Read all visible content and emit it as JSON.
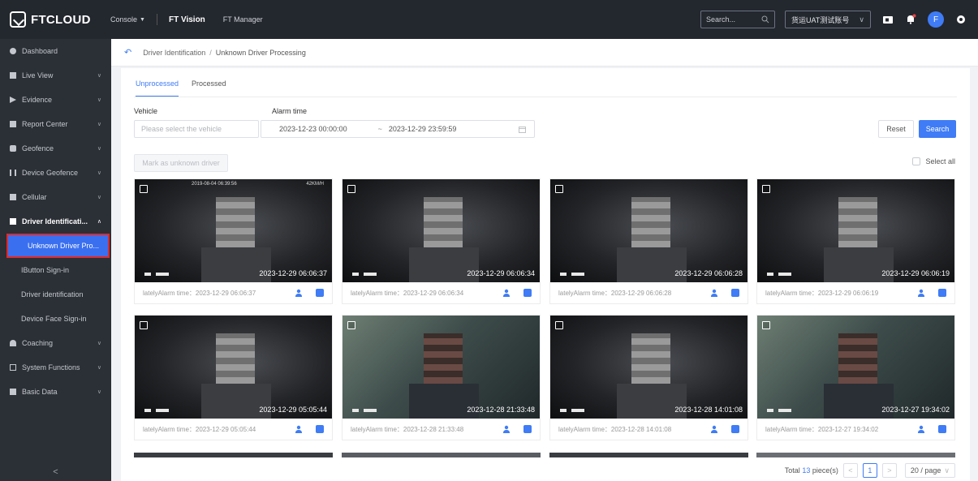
{
  "header": {
    "brand": "FTCLOUD",
    "console": "Console",
    "nav": [
      "FT Vision",
      "FT Manager"
    ],
    "search_placeholder": "Search...",
    "account": "货运UAT测试账号",
    "avatar_letter": "F"
  },
  "sidebar": {
    "items": [
      {
        "label": "Dashboard",
        "icon": "dashboard-icon",
        "has_children": false
      },
      {
        "label": "Live View",
        "icon": "live-view-icon",
        "has_children": true
      },
      {
        "label": "Evidence",
        "icon": "evidence-icon",
        "has_children": true
      },
      {
        "label": "Report Center",
        "icon": "report-icon",
        "has_children": true
      },
      {
        "label": "Geofence",
        "icon": "geofence-icon",
        "has_children": true
      },
      {
        "label": "Device Geofence",
        "icon": "device-geofence-icon",
        "has_children": true
      },
      {
        "label": "Cellular",
        "icon": "cellular-icon",
        "has_children": true
      },
      {
        "label": "Driver Identificati...",
        "icon": "driver-id-icon",
        "has_children": true,
        "open": true
      },
      {
        "label": "Coaching",
        "icon": "coaching-icon",
        "has_children": true
      },
      {
        "label": "System Functions",
        "icon": "system-icon",
        "has_children": true
      },
      {
        "label": "Basic Data",
        "icon": "basic-data-icon",
        "has_children": true
      }
    ],
    "sub_items": [
      "Unknown Driver Pro...",
      "IButton Sign-in",
      "Driver identification",
      "Device Face Sign-in"
    ],
    "active_sub": "Unknown Driver Pro...",
    "collapse_glyph": "<"
  },
  "breadcrumb": {
    "parent": "Driver Identification",
    "separator": "/",
    "current": "Unknown Driver Processing"
  },
  "tabs": {
    "unprocessed": "Unprocessed",
    "processed": "Processed"
  },
  "filters": {
    "vehicle_label": "Vehicle",
    "vehicle_placeholder": "Please select the vehicle",
    "alarm_label": "Alarm time",
    "alarm_start": "2023-12-23 00:00:00",
    "range_sep": "~",
    "alarm_end": "2023-12-29 23:59:59",
    "reset": "Reset",
    "search": "Search"
  },
  "actions": {
    "mark_unknown": "Mark as unknown driver",
    "select_all": "Select all"
  },
  "cards": [
    {
      "stamp": "2023-12-29 06:06:37",
      "footer": "latelyAlarm time：2023-12-29 06:06:37",
      "overlay_top": "2019-08-04 06:39:56",
      "overlay_speed": "42KM/H",
      "tone": "dark"
    },
    {
      "stamp": "2023-12-29 06:06:34",
      "footer": "latelyAlarm time：2023-12-29 06:06:34",
      "tone": "dark"
    },
    {
      "stamp": "2023-12-29 06:06:28",
      "footer": "latelyAlarm time：2023-12-29 06:06:28",
      "tone": "dark"
    },
    {
      "stamp": "2023-12-29 06:06:19",
      "footer": "latelyAlarm time：2023-12-29 06:06:19",
      "tone": "dark"
    },
    {
      "stamp": "2023-12-29 05:05:44",
      "footer": "latelyAlarm time：2023-12-29 05:05:44",
      "tone": "dark"
    },
    {
      "stamp": "2023-12-28 21:33:48",
      "footer": "latelyAlarm time：2023-12-28 21:33:48",
      "tone": "color"
    },
    {
      "stamp": "2023-12-28 14:01:08",
      "footer": "latelyAlarm time：2023-12-28 14:01:08",
      "tone": "dark"
    },
    {
      "stamp": "2023-12-27 19:34:02",
      "footer": "latelyAlarm time：2023-12-27 19:34:02",
      "tone": "color"
    }
  ],
  "pagination": {
    "total_prefix": "Total",
    "total_count": "13",
    "total_suffix": "piece(s)",
    "current_page": "1",
    "page_size": "20 / page"
  },
  "colors": {
    "accent": "#3f7cf5",
    "sidebar_bg": "#2b2f36",
    "topbar_bg": "#23272e",
    "active_outline": "#e02a2a"
  }
}
